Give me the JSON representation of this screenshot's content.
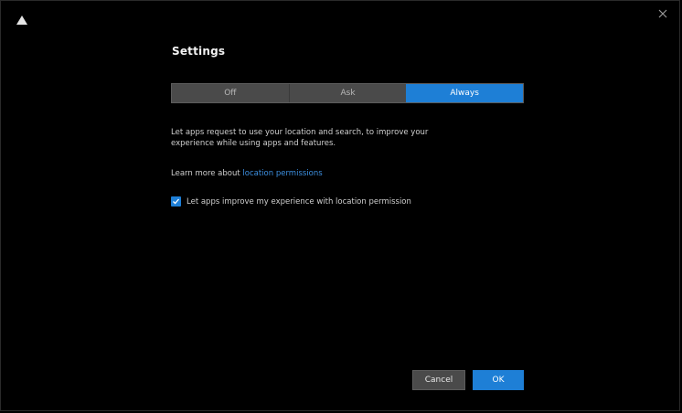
{
  "window": {
    "logo_icon": "app-logo-icon",
    "close_icon": "close-icon"
  },
  "panel": {
    "title": "Settings",
    "modes": [
      {
        "label": "Off",
        "active": false
      },
      {
        "label": "Ask",
        "active": false
      },
      {
        "label": "Always",
        "active": true
      }
    ],
    "description": "Let apps request to use your location and search, to improve your experience while using apps and features.",
    "learn_prefix": "Learn more about",
    "learn_link": "location permissions",
    "checkbox_label": "Let apps improve my experience with location permission",
    "checkbox_checked": true
  },
  "footer": {
    "cancel_label": "Cancel",
    "ok_label": "OK"
  },
  "colors": {
    "accent": "#1e7fd6",
    "background": "#000000",
    "segment_bg": "#4a4a4a"
  }
}
